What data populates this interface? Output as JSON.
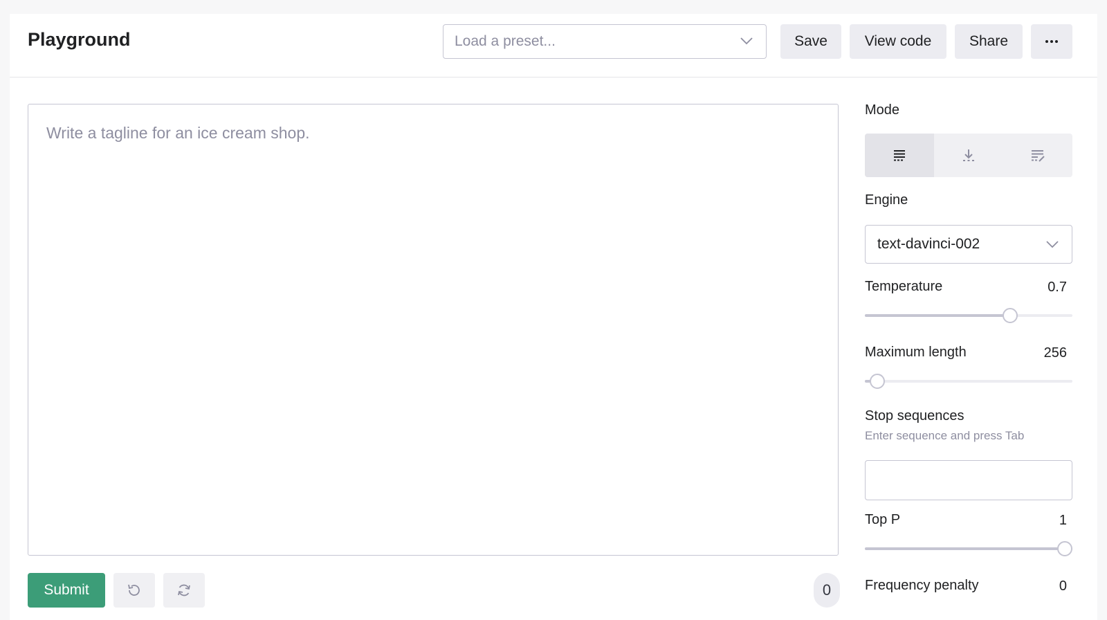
{
  "header": {
    "title": "Playground",
    "preset_placeholder": "Load a preset...",
    "save_label": "Save",
    "view_code_label": "View code",
    "share_label": "Share"
  },
  "editor": {
    "placeholder": "Write a tagline for an ice cream shop."
  },
  "footer": {
    "submit_label": "Submit",
    "token_count": "0"
  },
  "sidebar": {
    "mode_label": "Mode",
    "modes": [
      {
        "icon": "complete-mode-icon",
        "active": true
      },
      {
        "icon": "insert-mode-icon",
        "active": false
      },
      {
        "icon": "edit-mode-icon",
        "active": false
      }
    ],
    "engine_label": "Engine",
    "engine_value": "text-davinci-002",
    "temperature": {
      "label": "Temperature",
      "value": "0.7",
      "fraction": 0.7
    },
    "max_length": {
      "label": "Maximum length",
      "value": "256",
      "fraction": 0.06
    },
    "stop_sequences": {
      "label": "Stop sequences",
      "hint": "Enter sequence and press Tab",
      "value": ""
    },
    "top_p": {
      "label": "Top P",
      "value": "1",
      "fraction": 1.0
    },
    "frequency_penalty": {
      "label": "Frequency penalty",
      "value": "0"
    }
  },
  "colors": {
    "accent_green": "#3c9d78",
    "border": "#c5c5d2",
    "muted_text": "#8e8ea0"
  }
}
